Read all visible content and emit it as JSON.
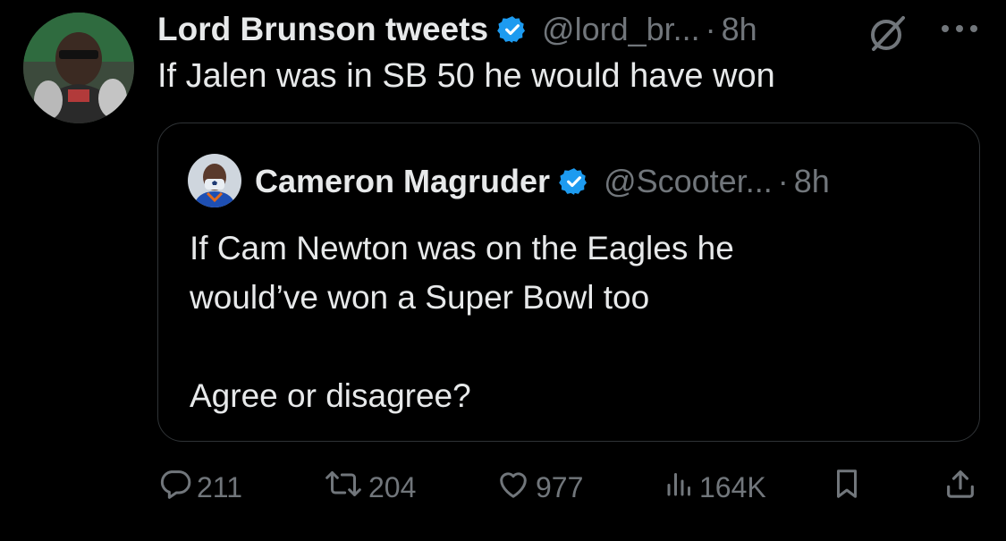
{
  "author": {
    "name": "Lord Brunson tweets",
    "handle": "@lord_br...",
    "separator": "·",
    "time": "8h",
    "verified": true
  },
  "tweet": {
    "text": "If Jalen was in SB 50 he would have won"
  },
  "quoted": {
    "name": "Cameron Magruder",
    "handle": "@Scooter...",
    "separator": "·",
    "time": "8h",
    "verified": true,
    "text": "If Cam Newton was on the Eagles he\nwould’ve won a Super Bowl too\n\nAgree or disagree?"
  },
  "stats": {
    "replies": "211",
    "retweets": "204",
    "likes": "977",
    "views": "164K"
  },
  "icons": {
    "header": [
      "grok-icon",
      "more-icon"
    ],
    "actions": [
      "reply-icon",
      "retweet-icon",
      "like-icon",
      "views-icon",
      "bookmark-icon",
      "share-icon"
    ]
  },
  "colors": {
    "background": "#000000",
    "text_primary": "#e7e9ea",
    "text_secondary": "#71767b",
    "verified_badge": "#1d9bf0",
    "border": "#2f3336"
  }
}
